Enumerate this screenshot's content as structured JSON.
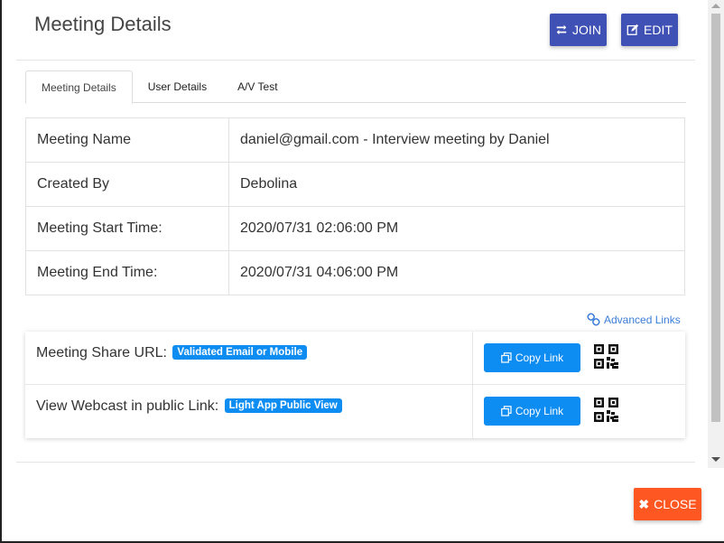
{
  "header": {
    "title": "Meeting Details",
    "join_label": "JOIN",
    "edit_label": "EDIT"
  },
  "tabs": [
    {
      "label": "Meeting Details",
      "active": true
    },
    {
      "label": "User Details",
      "active": false
    },
    {
      "label": "A/V Test",
      "active": false
    }
  ],
  "details": [
    {
      "label": "Meeting Name",
      "value": "daniel@gmail.com - Interview meeting by Daniel"
    },
    {
      "label": "Created By",
      "value": "Debolina"
    },
    {
      "label": "Meeting Start Time:",
      "value": "2020/07/31 02:06:00 PM"
    },
    {
      "label": "Meeting End Time:",
      "value": "2020/07/31 04:06:00 PM"
    }
  ],
  "advanced_links_label": "Advanced Links",
  "share_links": [
    {
      "label": "Meeting Share URL:",
      "badge": "Validated Email or Mobile",
      "copy_label": "Copy Link"
    },
    {
      "label": "View Webcast in public Link:",
      "badge": "Light App Public View",
      "copy_label": "Copy Link"
    }
  ],
  "footer": {
    "close_label": "CLOSE"
  },
  "colors": {
    "primary": "#3f51b5",
    "info": "#0d8cf2",
    "danger": "#ff5722",
    "link": "#3b7dd8"
  },
  "icons": {
    "join": "exchange-icon",
    "edit": "edit-icon",
    "advanced": "link-icon",
    "copy": "copy-icon",
    "qr": "qr-code-icon",
    "close": "close-icon"
  }
}
